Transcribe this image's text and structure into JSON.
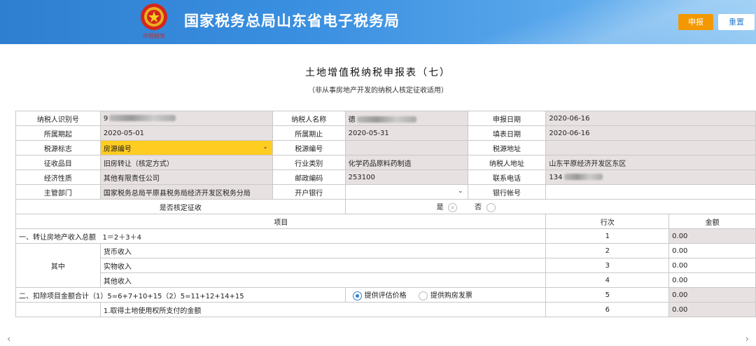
{
  "header": {
    "title": "国家税务总局山东省电子税务局",
    "submit_label": "申报",
    "reset_label": "重置"
  },
  "form": {
    "title": "土地增值税纳税申报表（七）",
    "subtitle": "（非从事房地产开发的纳税人核定征收适用）"
  },
  "info": {
    "taxpayer_id_label": "纳税人识别号",
    "taxpayer_id_value": "9",
    "taxpayer_name_label": "纳税人名称",
    "taxpayer_name_value": "德",
    "declare_date_label": "申报日期",
    "declare_date_value": "2020-06-16",
    "period_start_label": "所属期起",
    "period_start_value": "2020-05-01",
    "period_end_label": "所属期止",
    "period_end_value": "2020-05-31",
    "fill_date_label": "填表日期",
    "fill_date_value": "2020-06-16",
    "source_flag_label": "税源标志",
    "source_flag_value": "房源编号",
    "source_no_label": "税源编号",
    "source_no_value": "",
    "source_addr_label": "税源地址",
    "source_addr_value": "",
    "levy_item_label": "征收品目",
    "levy_item_value": "旧房转让（核定方式）",
    "industry_label": "行业类别",
    "industry_value": "化学药品原料药制造",
    "taxpayer_addr_label": "纳税人地址",
    "taxpayer_addr_value": "山东平原经济开发区东区",
    "econ_type_label": "经济性质",
    "econ_type_value": "其他有限责任公司",
    "postcode_label": "邮政编码",
    "postcode_value": "253100",
    "phone_label": "联系电话",
    "phone_value": "134",
    "dept_label": "主管部门",
    "dept_value": "国家税务总局平原县税务局经济开发区税务分局",
    "bank_label": "开户银行",
    "bank_value": "",
    "account_label": "银行帐号",
    "account_value": "",
    "assess_label": "是否核定征收",
    "assess_yes": "是",
    "assess_no": "否"
  },
  "table": {
    "col_item": "项目",
    "col_row": "行次",
    "col_amount": "金额",
    "r1_label": "一、转让房地产收入总额",
    "r1_formula": "1＝2＋3＋4",
    "r1_no": "1",
    "r1_amt": "0.00",
    "among_label": "其中",
    "r2_label": "货币收入",
    "r2_no": "2",
    "r2_amt": "0.00",
    "r3_label": "实物收入",
    "r3_no": "3",
    "r3_amt": "0.00",
    "r4_label": "其他收入",
    "r4_no": "4",
    "r4_amt": "0.00",
    "r5_label": "二、扣除项目金额合计（1）5=6+7+10+15（2）5=11+12+14+15",
    "r5_opt1": "提供评估价格",
    "r5_opt2": "提供购房发票",
    "r5_no": "5",
    "r5_amt": "0.00",
    "r6_label": "1.取得土地使用权所支付的金额",
    "r6_no": "6",
    "r6_amt": "0.00"
  },
  "colors": {
    "header_blue": "#3a8fe0",
    "submit_orange": "#f39800",
    "select_yellow": "#ffcc22",
    "readonly_gray": "#e8e1e1"
  }
}
